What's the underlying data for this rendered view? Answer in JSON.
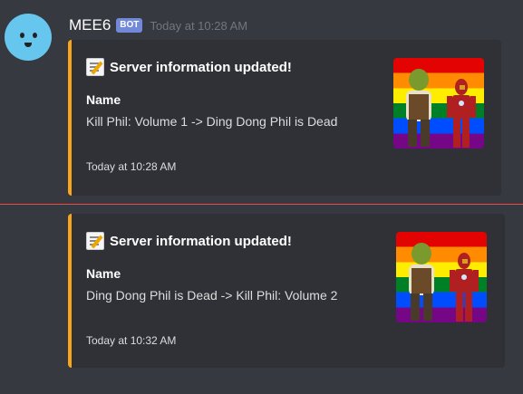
{
  "author": {
    "name": "MEE6",
    "tag": "BOT",
    "timestamp": "Today at 10:28 AM"
  },
  "messages": [
    {
      "title": "Server information updated!",
      "field_name": "Name",
      "field_value": "Kill Phil: Volume 1 -> Ding Dong Phil is Dead",
      "footer": "Today at 10:28 AM",
      "accent_color": "#faa61a"
    },
    {
      "title": "Server information updated!",
      "field_name": "Name",
      "field_value": "Ding Dong Phil is Dead -> Kill Phil: Volume 2",
      "footer": "Today at 10:32 AM",
      "accent_color": "#faa61a"
    }
  ],
  "icons": {
    "title_icon": "memo-icon"
  },
  "colors": {
    "divider": "#f04747",
    "bot_tag": "#7289da"
  }
}
